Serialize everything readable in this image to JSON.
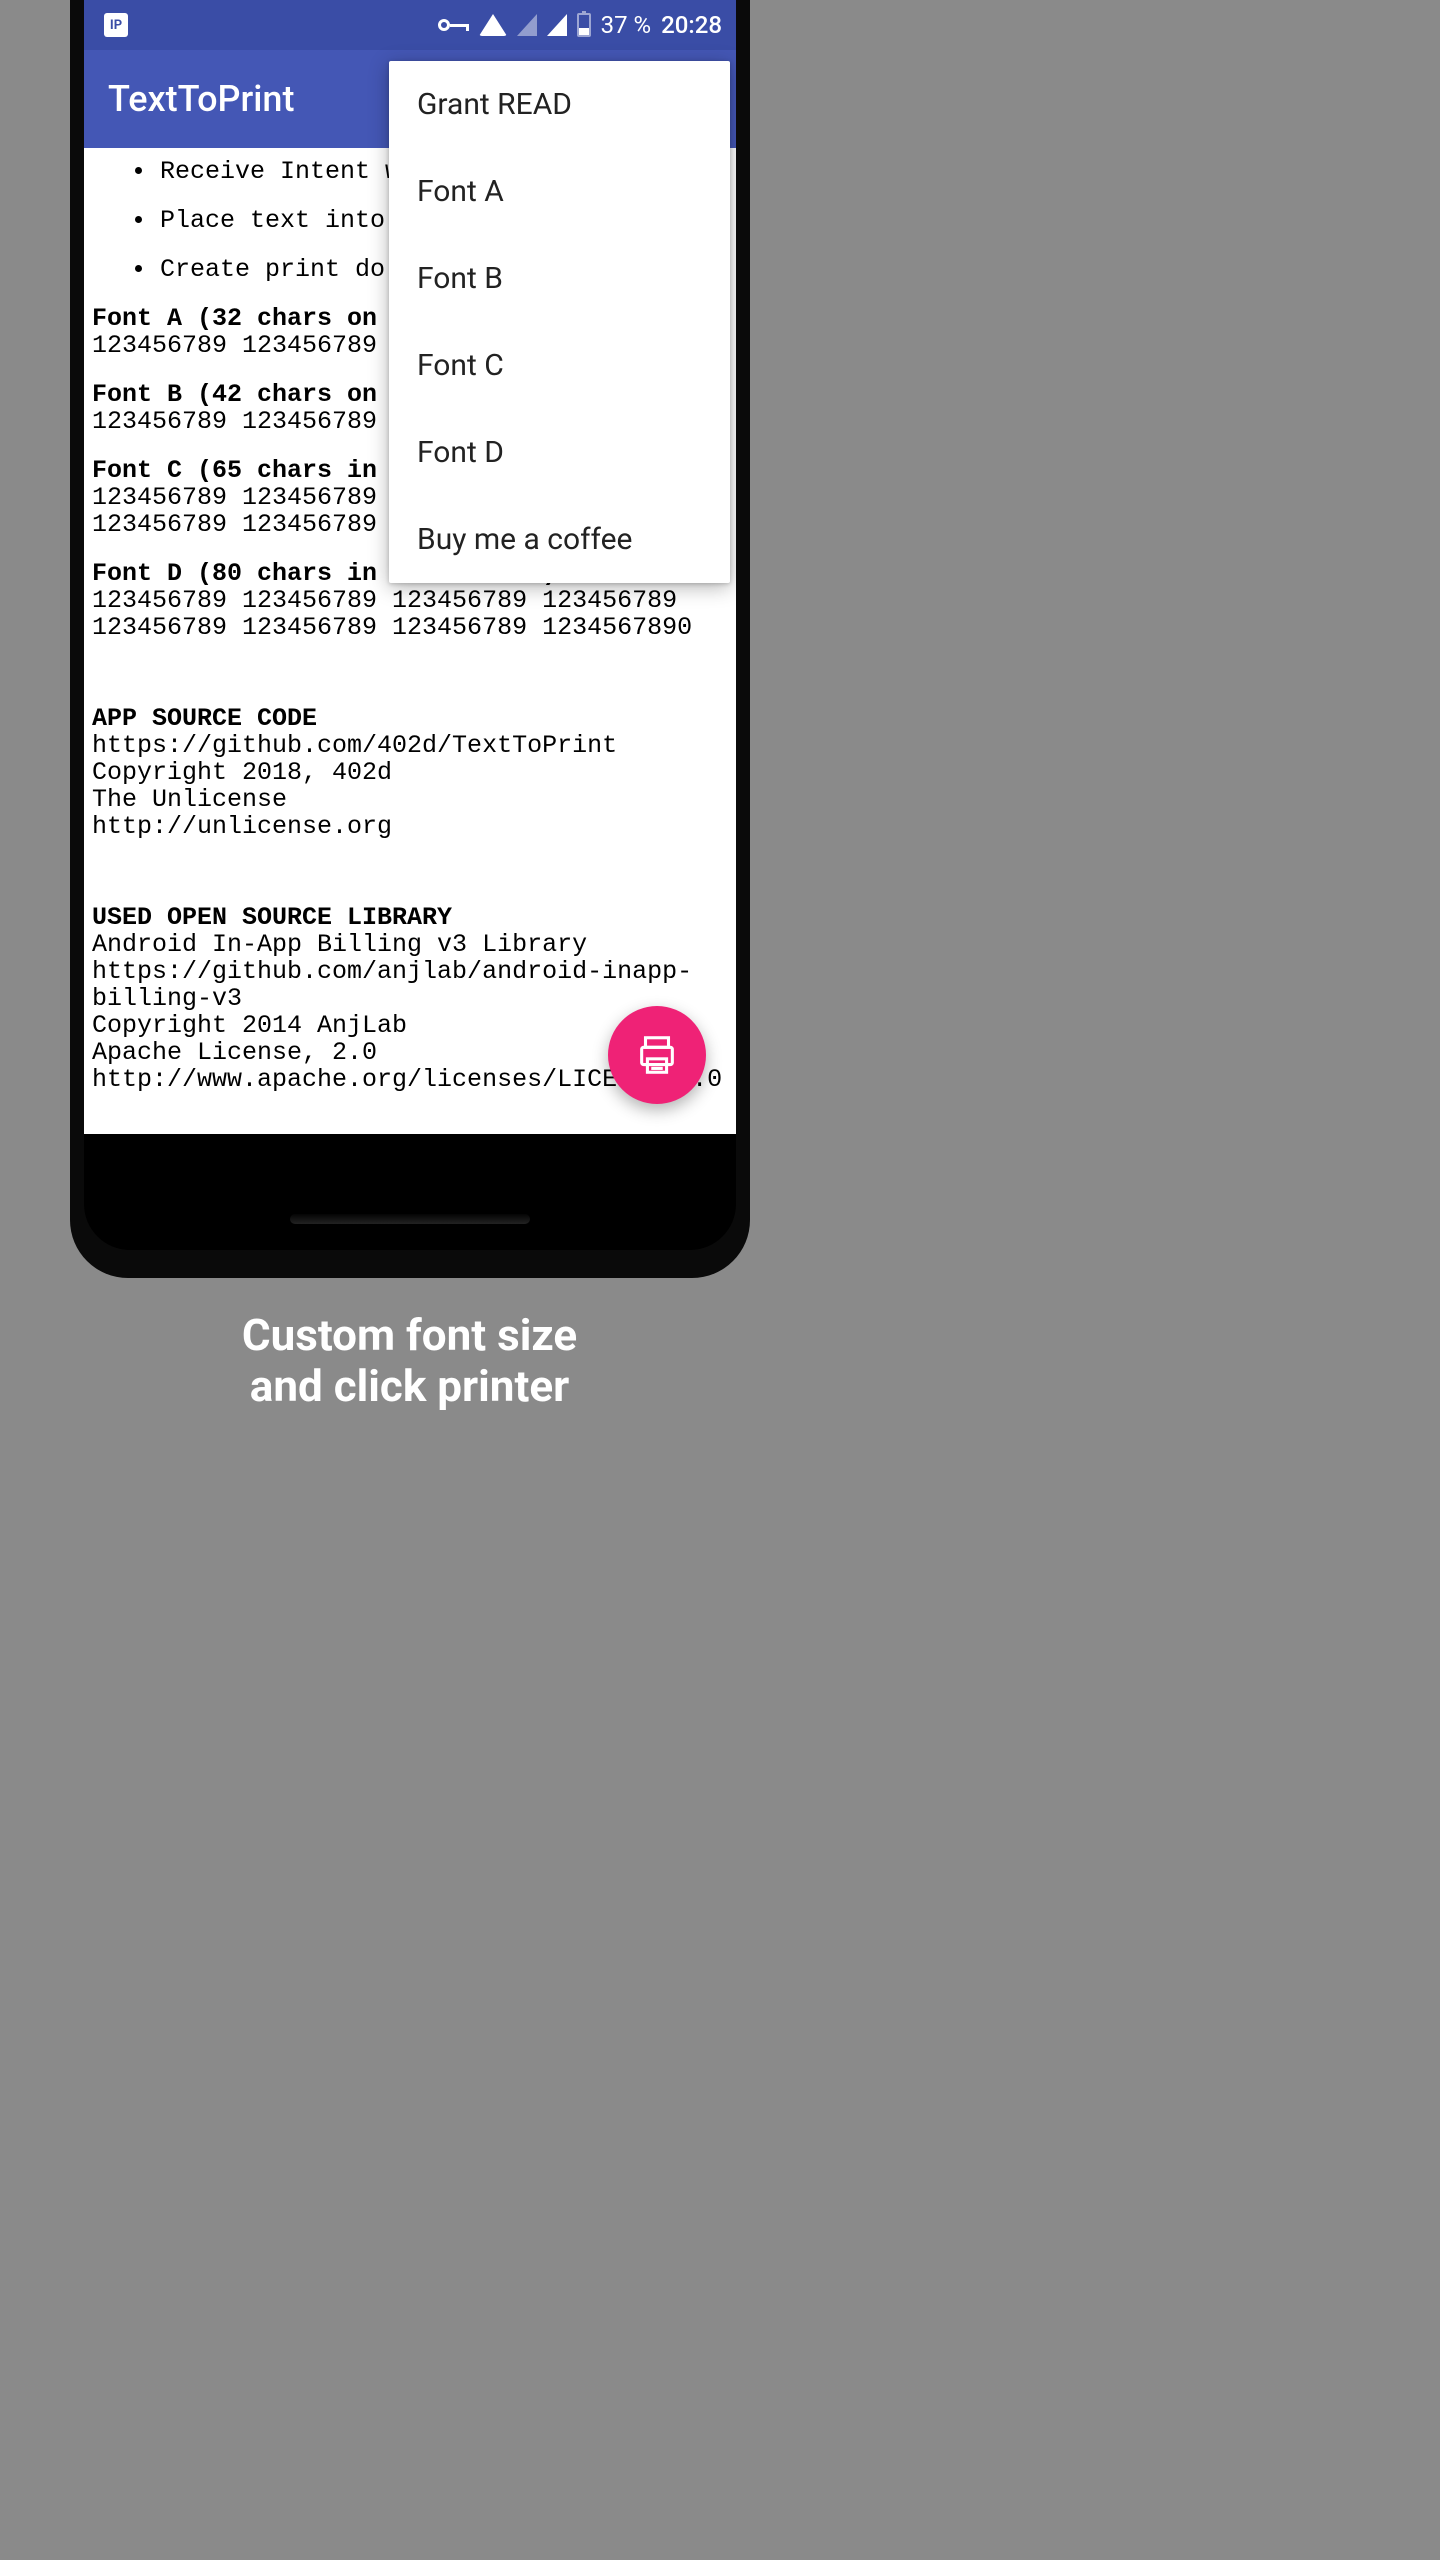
{
  "statusBar": {
    "ipLabel": "IP",
    "batteryPercent": "37 %",
    "time": "20:28"
  },
  "appBar": {
    "title": "TextToPrint"
  },
  "menu": {
    "items": [
      {
        "label": "Grant READ"
      },
      {
        "label": "Font A"
      },
      {
        "label": "Font B"
      },
      {
        "label": "Font C"
      },
      {
        "label": "Font D"
      },
      {
        "label": "Buy me a coffee"
      }
    ]
  },
  "content": {
    "bullets": [
      "Receive Intent with text/plain",
      "Place text into",
      "Create print do"
    ],
    "fontA": {
      "heading": "Font A (32 chars on",
      "line1": "123456789 123456789"
    },
    "fontB": {
      "heading": "Font B (42 chars on",
      "line1": "123456789 123456789"
    },
    "fontC": {
      "heading": "Font C (65 chars in",
      "line1": "123456789 123456789",
      "line2": "123456789 123456789"
    },
    "fontD": {
      "heading": "Font D (80 chars in line on A4)",
      "line1": "123456789 123456789 123456789 123456789",
      "line2": "123456789 123456789 123456789 1234567890"
    },
    "source": {
      "heading": "APP SOURCE CODE",
      "line1": "https://github.com/402d/TextToPrint",
      "line2": "Copyright 2018, 402d",
      "line3": "The Unlicense",
      "line4": "http://unlicense.org"
    },
    "library": {
      "heading": "USED OPEN SOURCE LIBRARY",
      "line1": "Android In-App Billing v3 Library",
      "line2": "https://github.com/anjlab/android-inapp-billing-v3",
      "line3": "Copyright 2014 AnjLab",
      "line4": "Apache License, 2.0",
      "line5": "http://www.apache.org/licenses/LICENSE-2.0"
    }
  },
  "caption": {
    "line1": "Custom font size",
    "line2": "and click printer"
  }
}
